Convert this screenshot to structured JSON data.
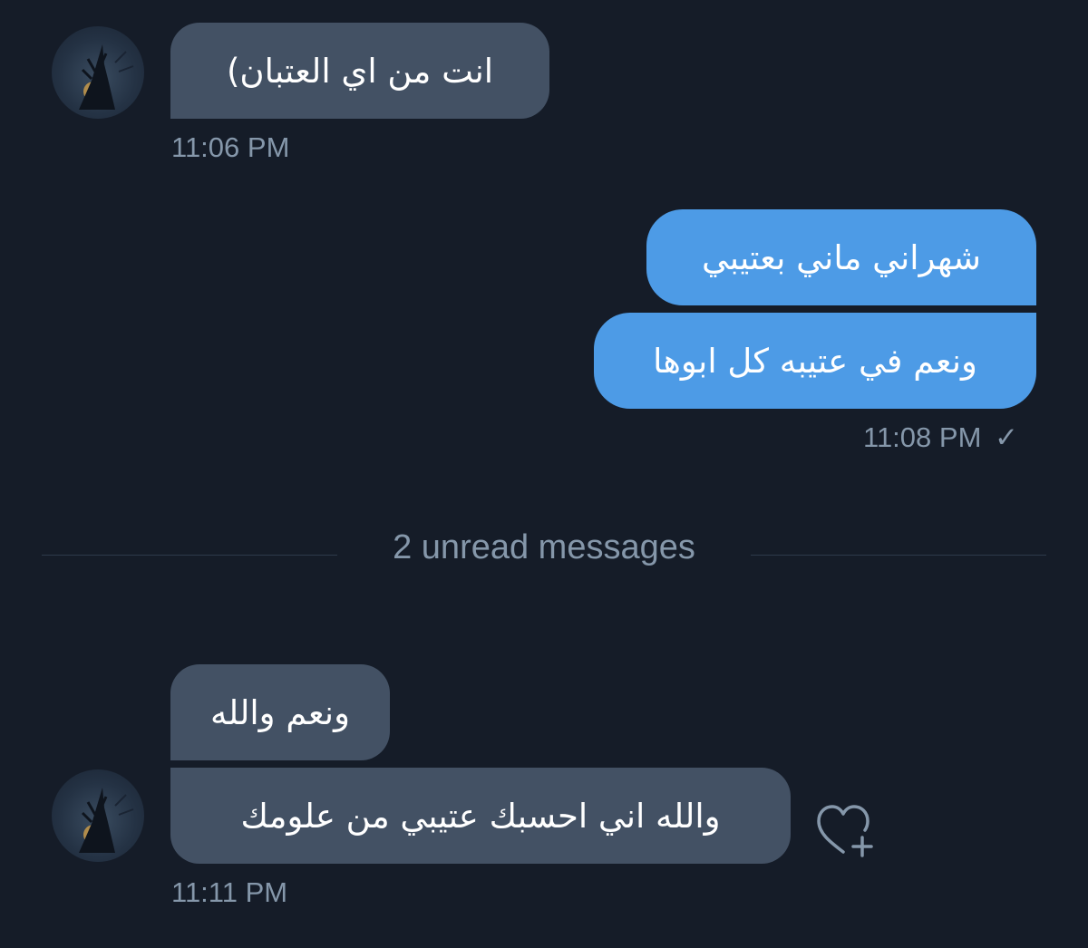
{
  "conversation": {
    "messages": [
      {
        "id": "m1",
        "direction": "incoming",
        "text": "انت من اي العتبان)"
      },
      {
        "id": "m2",
        "direction": "outgoing",
        "text": "شهراني ماني بعتيبي"
      },
      {
        "id": "m3",
        "direction": "outgoing",
        "text": "ونعم في عتيبه كل ابوها"
      },
      {
        "id": "m4",
        "direction": "incoming",
        "text": "ونعم والله"
      },
      {
        "id": "m5",
        "direction": "incoming",
        "text": "والله اني احسبك عتيبي من علومك"
      }
    ],
    "timestamps": {
      "t1": "11:06 PM",
      "t2": "11:08 PM",
      "t3": "11:11 PM"
    },
    "read_receipt_glyph": "✓",
    "unread_divider": "2 unread messages"
  },
  "icons": {
    "avatar": "avatar-icon",
    "react": "heart-plus-icon"
  },
  "colors": {
    "background": "#151c28",
    "incoming_bubble": "#435164",
    "outgoing_bubble": "#4d9be6",
    "meta_text": "#8597aa"
  }
}
